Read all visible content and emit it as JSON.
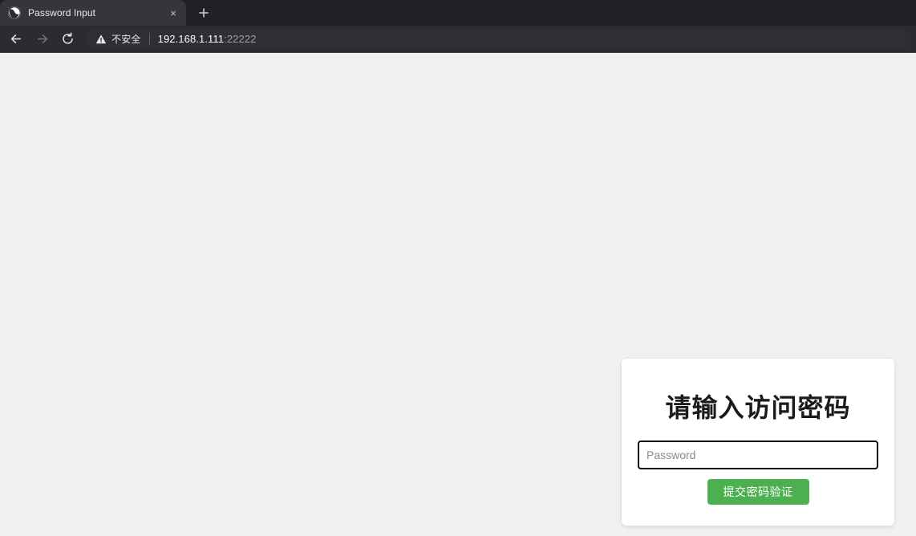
{
  "browser": {
    "tab": {
      "title": "Password Input",
      "favicon_name": "globe-favicon",
      "close_label": "×"
    },
    "new_tab_label": "+",
    "nav": {
      "back_label": "←",
      "forward_label": "→",
      "reload_label": "↻"
    },
    "omnibox": {
      "security_label": "不安全",
      "security_icon": "warning-triangle-icon",
      "host": "192.168.1.111",
      "port": ":22222"
    }
  },
  "page": {
    "background_color": "#f1f1f1",
    "card": {
      "title": "请输入访问密码",
      "password_placeholder": "Password",
      "password_value": "",
      "submit_label": "提交密码验证",
      "submit_color": "#4caf50"
    }
  }
}
